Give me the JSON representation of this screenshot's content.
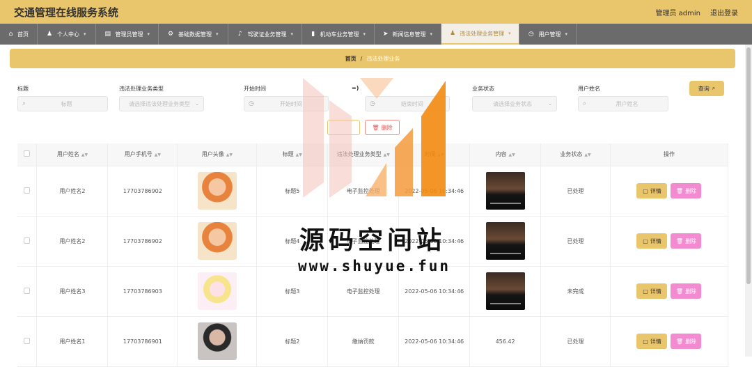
{
  "app": {
    "title": "交通管理在线服务系统"
  },
  "topbar": {
    "user_label": "管理员 admin",
    "logout_label": "退出登录"
  },
  "nav": [
    {
      "label": "首页",
      "icon": "home-icon"
    },
    {
      "label": "个人中心",
      "icon": "user-icon"
    },
    {
      "label": "管理员管理",
      "icon": "admin-icon"
    },
    {
      "label": "基础数据管理",
      "icon": "gear-icon"
    },
    {
      "label": "驾驶证业务管理",
      "icon": "mic-icon"
    },
    {
      "label": "机动车业务管理",
      "icon": "car-icon"
    },
    {
      "label": "新闻信息管理",
      "icon": "send-icon"
    },
    {
      "label": "违法处理业务管理",
      "icon": "user-icon",
      "active": true
    },
    {
      "label": "用户管理",
      "icon": "clock-icon"
    }
  ],
  "breadcrumb": {
    "home": "首页",
    "separator": "/",
    "current": "违法处理业务"
  },
  "filters": {
    "title_label": "标题",
    "title_placeholder": "标题",
    "type_label": "违法处理业务类型",
    "type_placeholder": "请选择违法处理业务类型",
    "start_label": "开始时间",
    "start_placeholder": "开始时间",
    "end_label": "=)",
    "end_placeholder": "结束时间",
    "status_label": "业务状态",
    "status_placeholder": "请选择业务状态",
    "name_label": "用户姓名",
    "name_placeholder": "用户姓名",
    "query_label": "查询"
  },
  "toolbar": {
    "delete_label": "删除"
  },
  "table": {
    "headers": {
      "name": "用户姓名",
      "phone": "用户手机号",
      "avatar": "用户头像",
      "title": "标题",
      "type": "违法处理业务类型",
      "time": "时间",
      "content": "内容",
      "status": "业务状态",
      "actions": "操作"
    },
    "rows": [
      {
        "name": "用户姓名2",
        "phone": "17703786902",
        "avatar": "photo-a",
        "title": "标题5",
        "type": "电子监控处理",
        "time": "2022-05-06 10:34:46",
        "content": "",
        "status": "已处理"
      },
      {
        "name": "用户姓名2",
        "phone": "17703786902",
        "avatar": "photo-a",
        "title": "标题4",
        "type": "电子监控处理",
        "time": "2022-05-06 10:34:46",
        "content": "",
        "status": "已处理"
      },
      {
        "name": "用户姓名3",
        "phone": "17703786903",
        "avatar": "photo-b",
        "title": "标题3",
        "type": "电子监控处理",
        "time": "2022-05-06 10:34:46",
        "content": "",
        "status": "未完成"
      },
      {
        "name": "用户姓名1",
        "phone": "17703786901",
        "avatar": "photo-c",
        "title": "标题2",
        "type": "缴纳罚款",
        "time": "2022-05-06 10:34:46",
        "content": "456.42",
        "status": "已处理"
      }
    ],
    "detail_label": "详情",
    "delete_label": "删除"
  },
  "watermark": {
    "text": "源码空间站",
    "url": "www.shuyue.fun"
  },
  "colors": {
    "accent": "#e9c56c",
    "nav_bg": "#6b6b6b",
    "danger": "#f28bd0"
  }
}
